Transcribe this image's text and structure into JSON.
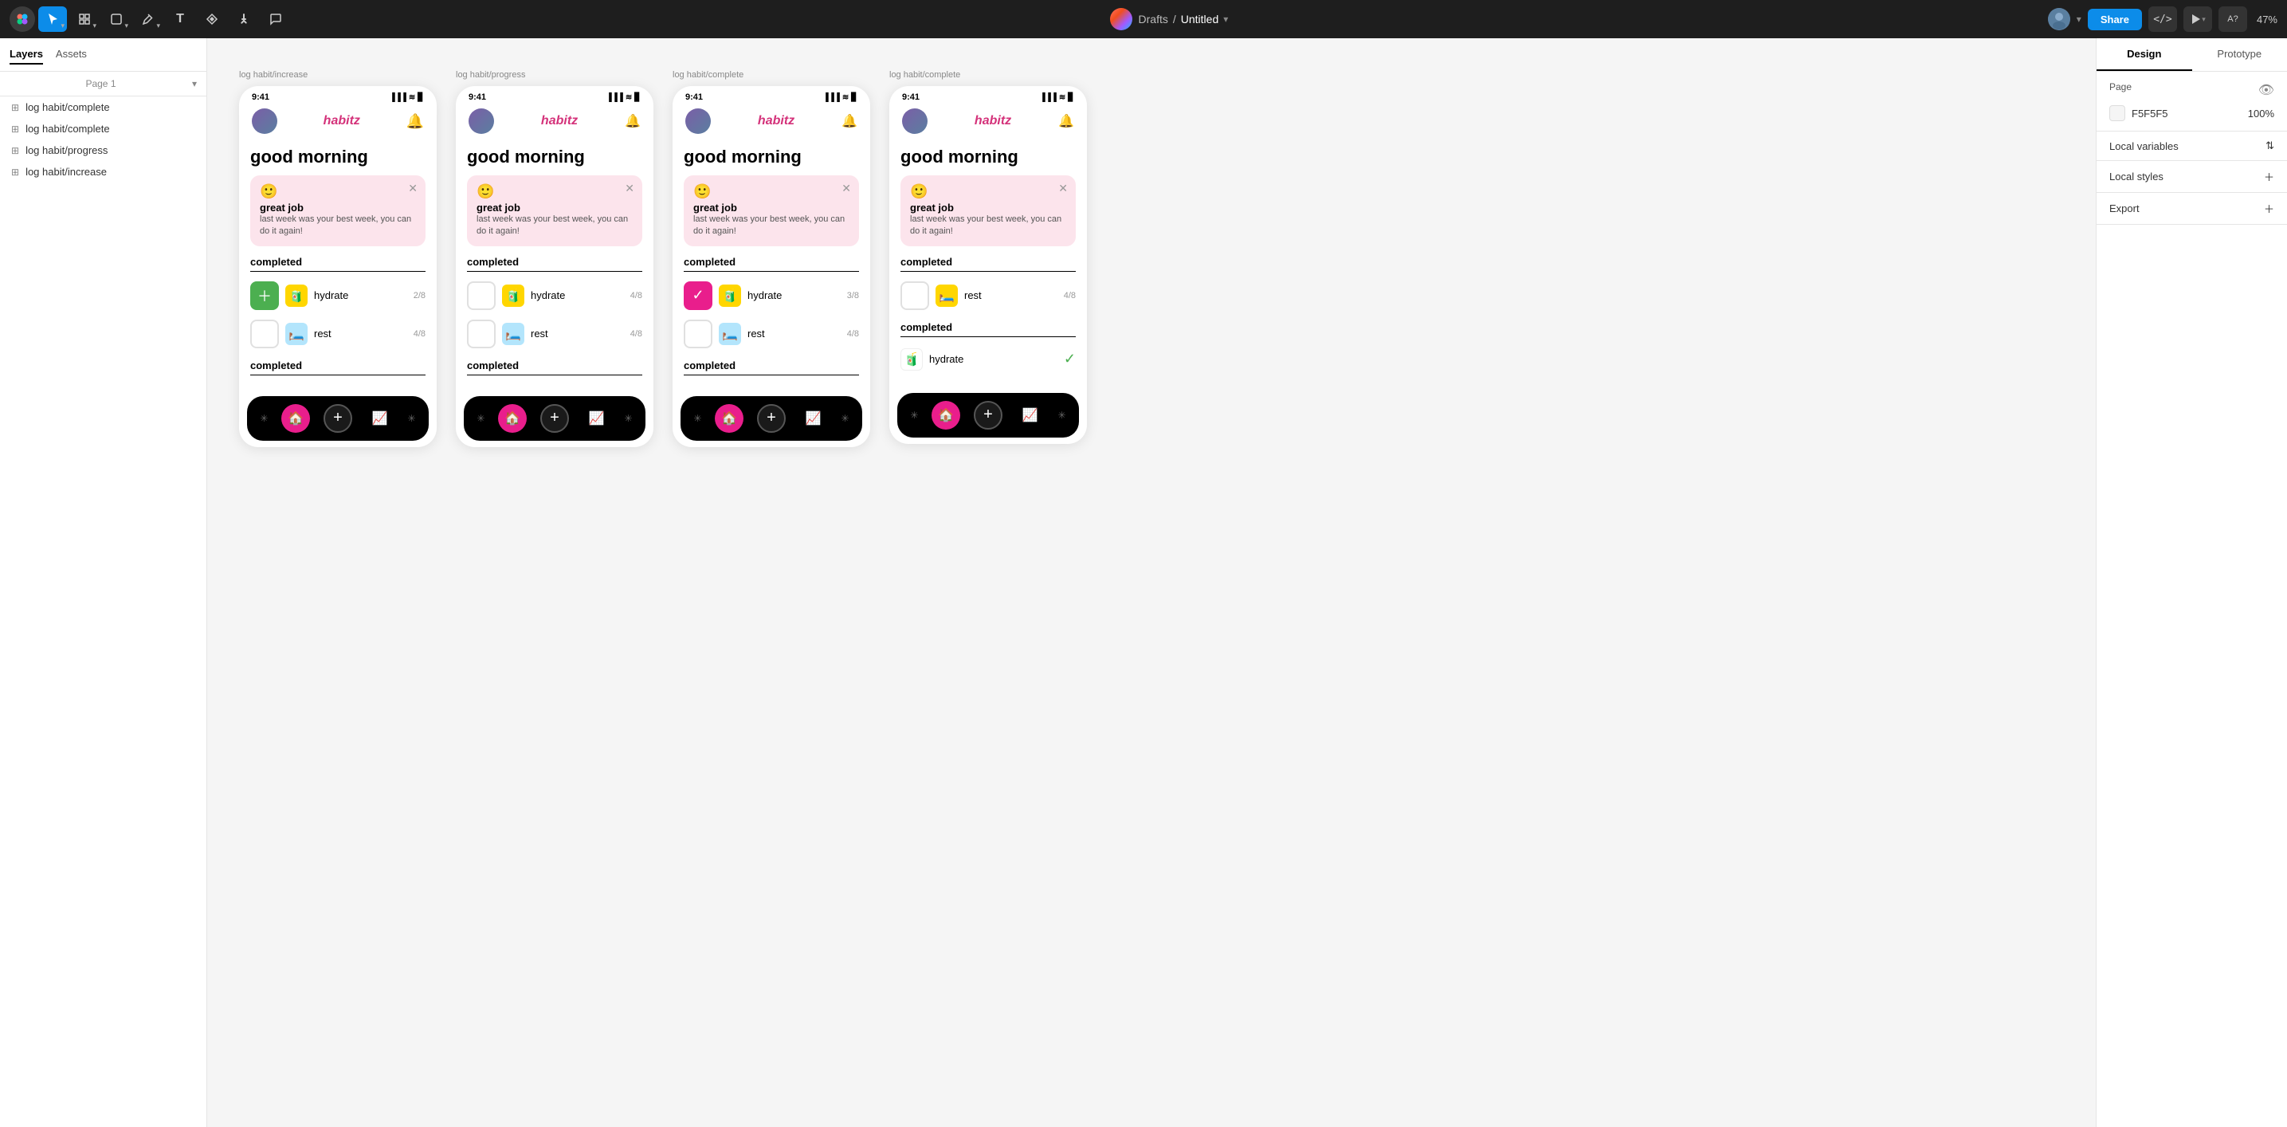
{
  "toolbar": {
    "title": "Untitled",
    "breadcrumb_sep": "/",
    "drafts": "Drafts",
    "share_label": "Share",
    "zoom": "47%",
    "tools": [
      "move",
      "frame",
      "shape",
      "pen",
      "text",
      "components",
      "hand",
      "comment"
    ]
  },
  "sidebar_left": {
    "tabs": [
      "Layers",
      "Assets"
    ],
    "page_label": "Page 1",
    "layers": [
      "log habit/complete",
      "log habit/complete",
      "log habit/progress",
      "log habit/increase"
    ]
  },
  "frames": [
    {
      "label": "log habit/increase",
      "status_time": "9:41",
      "greeting": "good morning",
      "notif_emoji": "🙂",
      "notif_title": "great job",
      "notif_text": "last week was your best week, you can do it again!",
      "section1": "completed",
      "habits": [
        {
          "name": "hydrate",
          "count": "2/8",
          "icon": "🧃",
          "checked": "add"
        },
        {
          "name": "rest",
          "count": "4/8",
          "icon": "🛏️",
          "checked": false
        }
      ],
      "section2": "completed"
    },
    {
      "label": "log habit/progress",
      "status_time": "9:41",
      "greeting": "good morning",
      "notif_emoji": "🙂",
      "notif_title": "great job",
      "notif_text": "last week was your best week, you can do it again!",
      "section1": "completed",
      "habits": [
        {
          "name": "hydrate",
          "count": "4/8",
          "icon": "🧃",
          "checked": false
        },
        {
          "name": "rest",
          "count": "4/8",
          "icon": "🛏️",
          "checked": false
        }
      ],
      "section2": "completed"
    },
    {
      "label": "log habit/complete",
      "status_time": "9:41",
      "greeting": "good morning",
      "notif_emoji": "🙂",
      "notif_title": "great job",
      "notif_text": "last week was your best week, you can do it again!",
      "section1": "completed",
      "habits": [
        {
          "name": "hydrate",
          "count": "3/8",
          "icon": "🧃",
          "checked": "pink"
        },
        {
          "name": "rest",
          "count": "4/8",
          "icon": "🛏️",
          "checked": false
        }
      ],
      "section2": "completed"
    },
    {
      "label": "log habit/complete",
      "status_time": "9:41",
      "greeting": "good morning",
      "notif_emoji": "🙂",
      "notif_title": "great job",
      "notif_text": "last week was your best week, you can do it again!",
      "section1": "completed",
      "habits": [
        {
          "name": "rest",
          "count": "4/8",
          "icon": "🛏️",
          "checked": false
        }
      ],
      "section2": "completed",
      "completed_habits": [
        {
          "name": "hydrate"
        }
      ]
    }
  ],
  "design_panel": {
    "tabs": [
      "Design",
      "Prototype"
    ],
    "page_label": "Page",
    "color_value": "F5F5F5",
    "opacity_value": "100%",
    "local_variables": "Local variables",
    "local_styles": "Local styles",
    "export": "Export"
  }
}
